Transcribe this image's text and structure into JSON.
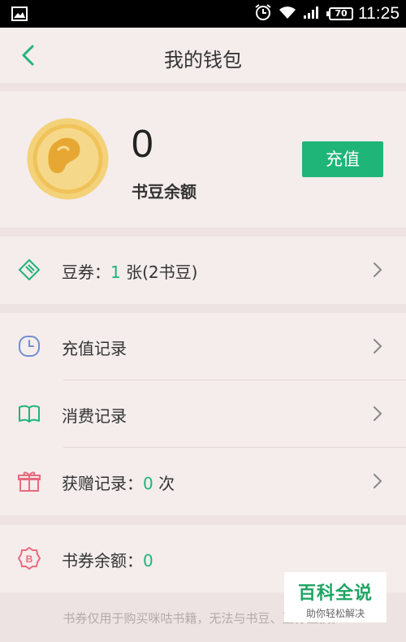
{
  "status_bar": {
    "time": "11:25",
    "battery": "70",
    "icons": [
      "gallery-icon",
      "alarm-icon",
      "wifi-icon",
      "signal-icon",
      "battery-icon"
    ]
  },
  "header": {
    "title": "我的钱包",
    "back_icon": "chevron-left-icon"
  },
  "wallet": {
    "balance": "0",
    "balance_label": "书豆余额",
    "recharge_label": "充值",
    "coin_icon": "bean-coin-icon"
  },
  "coupon_row": {
    "label_prefix": "豆券：",
    "count": "1",
    "label_suffix": " 张(2书豆)",
    "icon": "ticket-icon"
  },
  "records": {
    "recharge": {
      "label": "充值记录",
      "icon": "clock-icon"
    },
    "spend": {
      "label": "消费记录",
      "icon": "book-icon"
    },
    "gift": {
      "label_prefix": "获赠记录：",
      "count": "0",
      "label_suffix": " 次",
      "icon": "gift-icon"
    }
  },
  "voucher": {
    "label_prefix": "书券余额：",
    "value": "0",
    "icon": "voucher-badge-icon"
  },
  "footer_note": "书券仅用于购买咪咕书籍，无法与书豆、豆券互换。",
  "watermark": {
    "title": "百科全说",
    "subtitle": "助你轻松解决"
  },
  "colors": {
    "accent_green": "#1fb578",
    "background": "#ede3e3",
    "card": "#f5ecec",
    "coin_gold": "#f0c35a"
  }
}
